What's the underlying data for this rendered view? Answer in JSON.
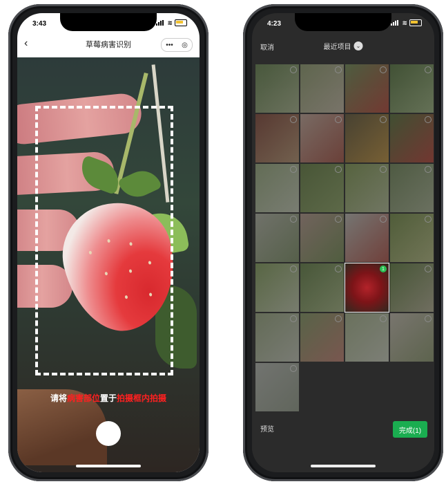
{
  "left_phone": {
    "status": {
      "time": "3:43"
    },
    "navbar": {
      "back_icon": "‹",
      "title": "草莓病害识别",
      "menu_icon": "•••",
      "close_icon": "◎"
    },
    "hint": {
      "part1": "请将",
      "red1": "病害部位",
      "part2": "置于",
      "red2": "拍摄框内拍摄"
    }
  },
  "right_phone": {
    "status": {
      "time": "4:23"
    },
    "picker": {
      "cancel_label": "取消",
      "album_label": "最近项目",
      "album_chevron": "⌄"
    },
    "selected_badge": "1",
    "preview_label": "预览",
    "confirm_label": "完成(1)"
  },
  "colors": {
    "accent_green": "#1aad50",
    "hint_red": "#ff2020",
    "check_green": "#2bbf54"
  }
}
